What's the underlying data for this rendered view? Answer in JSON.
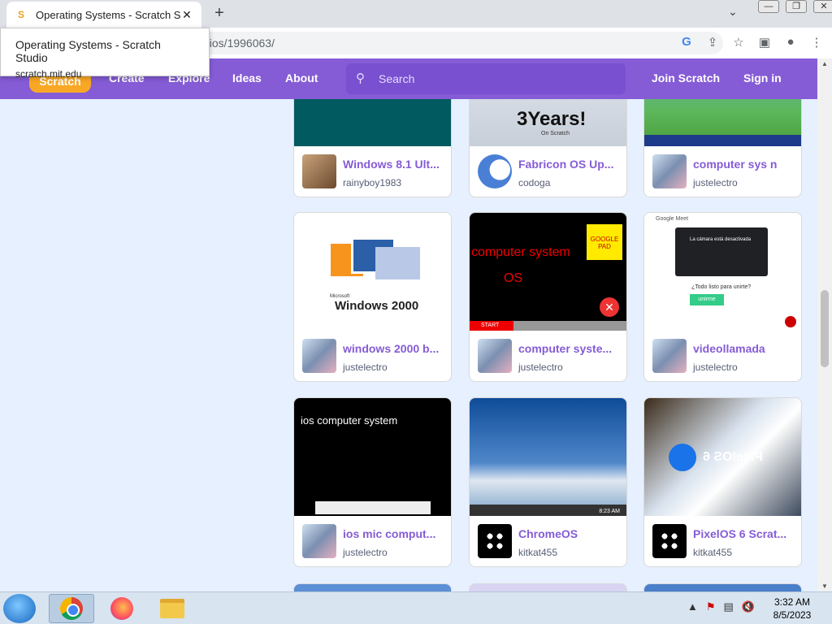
{
  "browser": {
    "tab_title": "Operating Systems - Scratch Studio",
    "tab_title_shown": "Operating Systems - Scratch Stuc",
    "url_visible": "dios/1996063/",
    "tooltip_title": "Operating Systems - Scratch Studio",
    "tooltip_domain": "scratch.mit.edu"
  },
  "nav": {
    "logo": "Scratch",
    "create": "Create",
    "explore": "Explore",
    "ideas": "Ideas",
    "about": "About",
    "search_placeholder": "Search",
    "join": "Join Scratch",
    "signin": "Sign in"
  },
  "projects": [
    {
      "title": "Windows 8.1 Ult...",
      "author": "rainyboy1983"
    },
    {
      "title": "Fabricon OS Up...",
      "author": "codoga"
    },
    {
      "title": "computer sys n",
      "author": "justelectro"
    },
    {
      "title": "windows 2000 b...",
      "author": "justelectro"
    },
    {
      "title": "computer syste...",
      "author": "justelectro"
    },
    {
      "title": "videollamada",
      "author": "justelectro"
    },
    {
      "title": "ios mic comput...",
      "author": "justelectro"
    },
    {
      "title": "ChromeOS",
      "author": "kitkat455"
    },
    {
      "title": "PixelOS 6 Scrat...",
      "author": "kitkat455"
    }
  ],
  "thumbs": {
    "fabricon_text": "3Years!",
    "fabricon_sub": "On Scratch",
    "win2000": "Windows 2000",
    "win2000_ms": "Microsoft",
    "cs_title": "computer system",
    "cs_os": "OS",
    "cs_pad": "GOOGLE PAD",
    "cs_start": "START",
    "meet_brand": "Google Meet",
    "meet_cam": "La cámara está desactivada",
    "meet_q": "¿Todo listo para unirte?",
    "meet_btn": "unirme",
    "ios_title": "ios computer system",
    "chrome_time": "8:23 AM",
    "pixel_text": "PixelOS 6"
  },
  "taskbar": {
    "time": "3:32 AM",
    "date": "8/5/2023"
  }
}
